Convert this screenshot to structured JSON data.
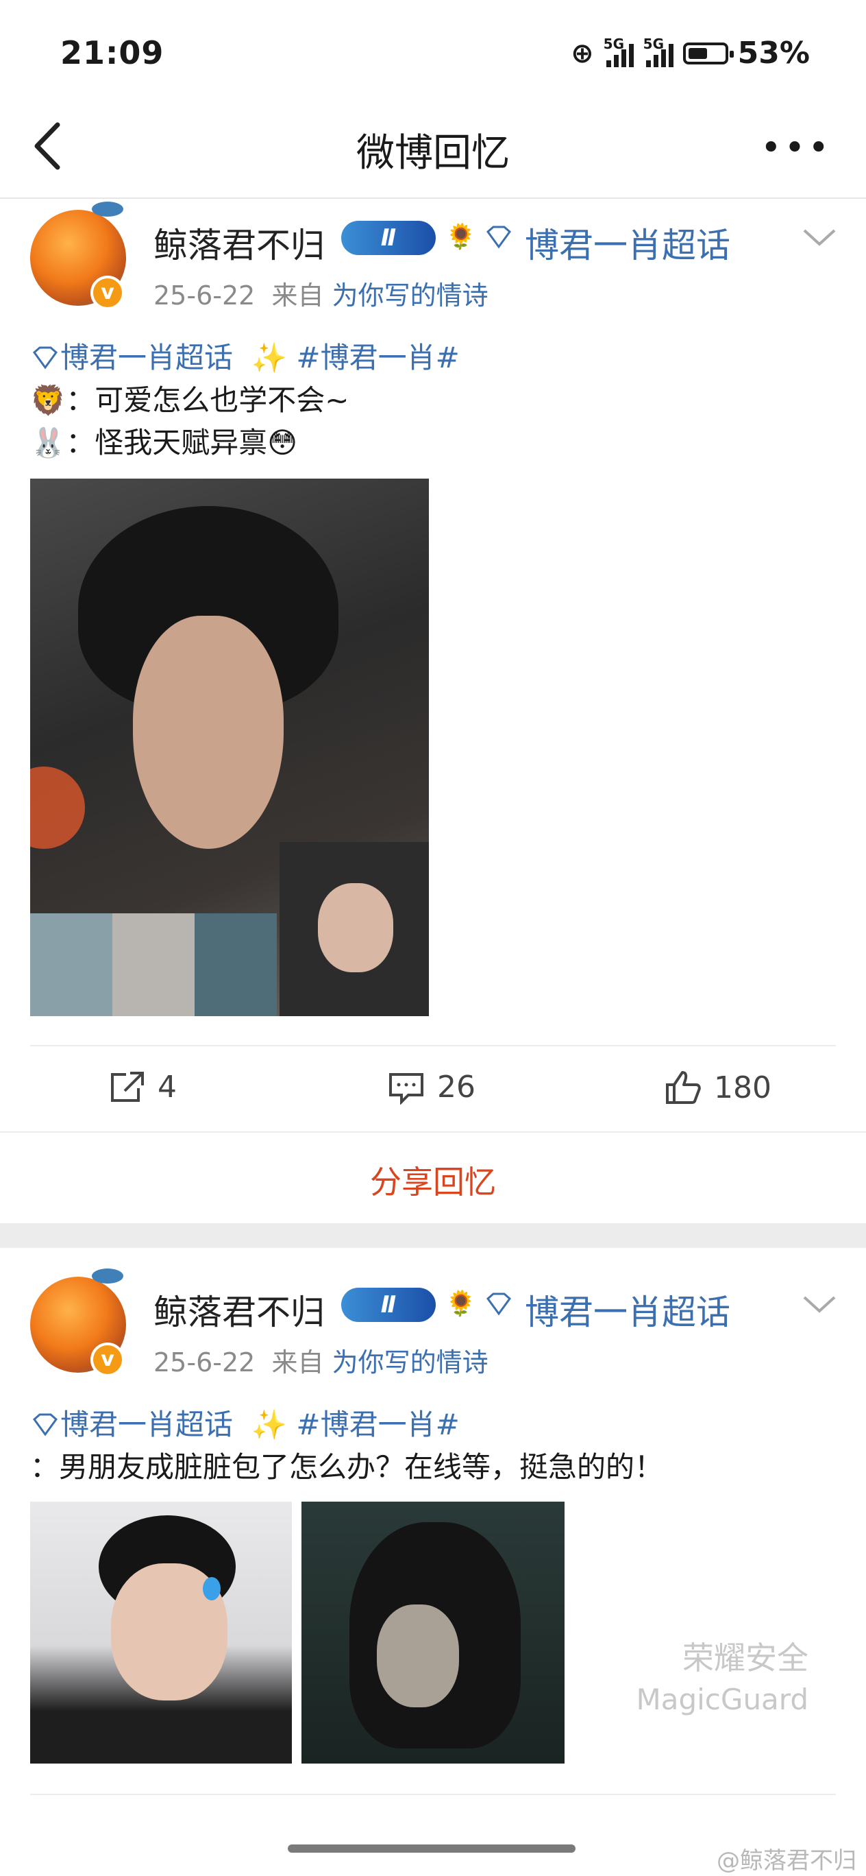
{
  "status": {
    "time": "21:09",
    "net1": "5G",
    "net2": "5G",
    "battery_pct": "53%",
    "battery_level": 0.53
  },
  "nav": {
    "title": "微博回忆",
    "more": "•••"
  },
  "posts": [
    {
      "user": "鲸落君不归",
      "level": "Ⅱ",
      "topic": "博君一肖超话",
      "date": "25-6-22",
      "from_label": "来自",
      "source": "为你写的情诗",
      "tags_topic": "博君一肖超话",
      "tags_sparkle": "✨",
      "tags_hash": "#博君一肖#",
      "lines": [
        "🦁：可爱怎么也学不会~",
        "🐰：怪我天赋异禀😳"
      ]
    },
    {
      "user": "鲸落君不归",
      "level": "Ⅱ",
      "topic": "博君一肖超话",
      "date": "25-6-22",
      "from_label": "来自",
      "source": "为你写的情诗",
      "tags_topic": "博君一肖超话",
      "tags_sparkle": "✨",
      "tags_hash": "#博君一肖#",
      "lines": [
        "：男朋友成脏脏包了怎么办？在线等，挺急的的！"
      ]
    }
  ],
  "actions": {
    "repost": "4",
    "comment": "26",
    "like": "180"
  },
  "share": "分享回忆",
  "watermark": {
    "line1": "荣耀安全",
    "line2": "MagicGuard",
    "weibo": "@鲸落君不归"
  }
}
